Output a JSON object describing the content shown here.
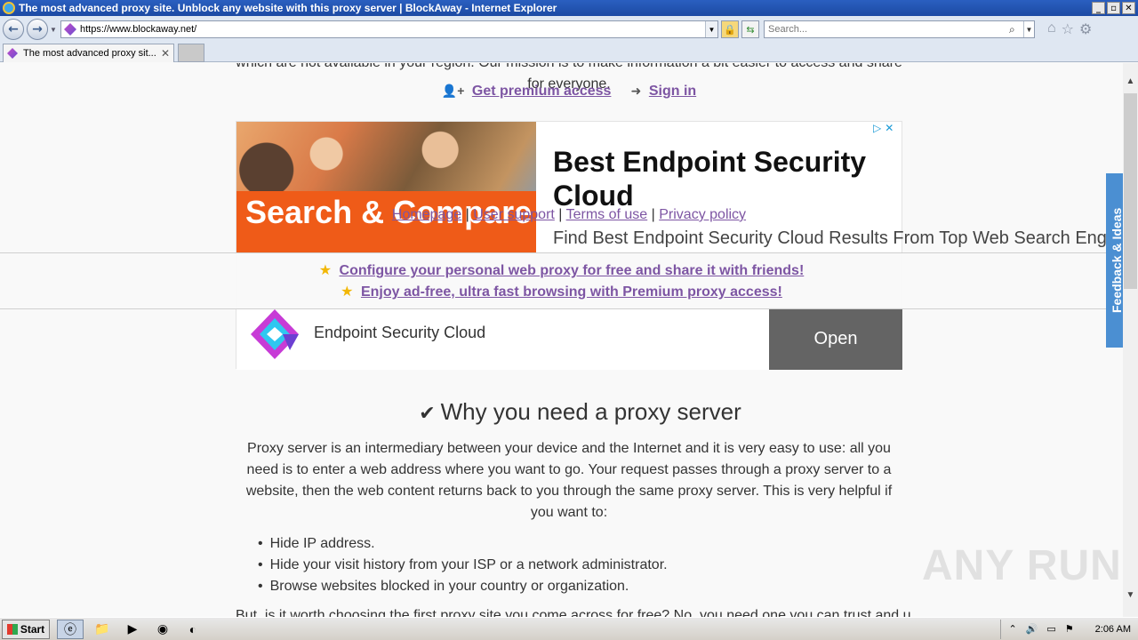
{
  "window": {
    "title": "The most advanced proxy site. Unblock any website with this proxy server | BlockAway - Internet Explorer",
    "btn_min": "_",
    "btn_max": "▫",
    "btn_close": "✕"
  },
  "navbar": {
    "back": "←",
    "forward": "→",
    "url": "https://www.blockaway.net/",
    "search_placeholder": "Search..."
  },
  "tab": {
    "title": "The most advanced proxy sit...",
    "close": "✕"
  },
  "page": {
    "intro": "which are not available in your region. Our mission is to make information a bit easier to access and share for everyone.",
    "premium_link": "Get premium access",
    "signin_link": "Sign in",
    "footer_links": {
      "homepage": "Homepage",
      "support": "User support",
      "terms": "Terms of use",
      "privacy": "Privacy policy"
    },
    "promo": {
      "configure": "Configure your personal web proxy for free and share it with friends!",
      "adfree": "Enjoy ad-free, ultra fast browsing with Premium proxy access!"
    },
    "feedback_label": "Feedback & Ideas",
    "why": {
      "heading": "Why you need a proxy server",
      "paragraph": "Proxy server is an intermediary between your device and the Internet and it is very easy to use: all you need is to enter a web address where you want to go. Your request passes through a proxy server to a website, then the web content returns back to you through the same proxy server. This is very helpful if you want to:",
      "items": [
        "Hide IP address.",
        "Hide your visit history from your ISP or a network administrator.",
        "Browse websites blocked in your country or organization."
      ],
      "cut_text": "But, is it worth choosing the first proxy site you come across for free? No, you need one you can trust and use safely on the Internet."
    }
  },
  "ad": {
    "image_headline": "Search & Compare Top Results",
    "title": "Best Endpoint Security Cloud",
    "description": "Find Best Endpoint Security Cloud Results From Top Web Search Engines",
    "brand": "Endpoint Security Cloud",
    "cta": "Open",
    "choice": "▷✕"
  },
  "watermark": "ANY RUN",
  "taskbar": {
    "start": "Start",
    "clock": "2:06 AM"
  }
}
